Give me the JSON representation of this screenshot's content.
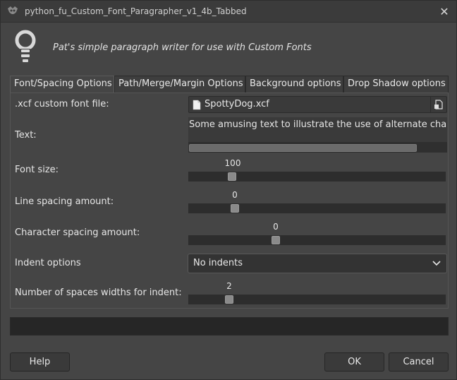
{
  "window": {
    "title": "python_fu_Custom_Font_Paragrapher_v1_4b_Tabbed"
  },
  "header": {
    "description": "Pat's simple paragraph writer for use with Custom Fonts"
  },
  "tabs": [
    {
      "label": "Font/Spacing Options",
      "active": true
    },
    {
      "label": "Path/Merge/Margin Options",
      "active": false
    },
    {
      "label": "Background options",
      "active": false
    },
    {
      "label": "Drop Shadow options",
      "active": false
    }
  ],
  "fields": {
    "font_file": {
      "label": ".xcf custom font file:",
      "value": "SpottyDog.xcf"
    },
    "text": {
      "label": "Text:",
      "value": "Some amusing text to illustrate the use of alternate cha"
    },
    "font_size": {
      "label": "Font size:",
      "value": "100"
    },
    "line_spacing": {
      "label": "Line spacing amount:",
      "value": "0"
    },
    "char_spacing": {
      "label": "Character spacing amount:",
      "value": "0"
    },
    "indent_options": {
      "label": "Indent options",
      "value": "No indents"
    },
    "indent_spaces": {
      "label": "Number of spaces widths for indent:",
      "value": "2"
    }
  },
  "buttons": {
    "help": "Help",
    "ok": "OK",
    "cancel": "Cancel"
  },
  "icons": {
    "app": "gimp-icon",
    "header": "lightbulb-icon",
    "file": "document-icon",
    "open": "open-file-icon",
    "close": "close-icon",
    "dropdown": "chevron-down-icon"
  }
}
